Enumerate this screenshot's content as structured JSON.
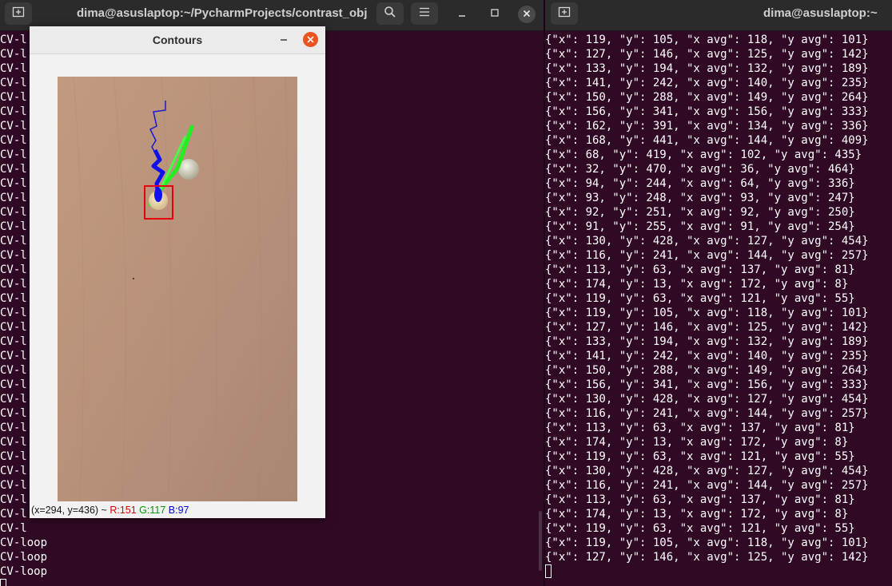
{
  "left_terminal": {
    "title": "dima@asuslaptop:~/PycharmProjects/contrast_obj",
    "lines": [
      "CV-l",
      "CV-l",
      "CV-l",
      "CV-l",
      "CV-l",
      "CV-l",
      "CV-l",
      "CV-l",
      "CV-l",
      "CV-l",
      "CV-l",
      "CV-l",
      "CV-l",
      "CV-l",
      "CV-l",
      "CV-l",
      "CV-l",
      "CV-l",
      "CV-l",
      "CV-l",
      "CV-l",
      "CV-l",
      "CV-l",
      "CV-l",
      "CV-l",
      "CV-l",
      "CV-l",
      "CV-l",
      "CV-l",
      "CV-l",
      "CV-l",
      "CV-l",
      "CV-l",
      "CV-l",
      "CV-l",
      "CV-loop",
      "CV-loop",
      "CV-loop"
    ]
  },
  "right_terminal": {
    "title": "dima@asuslaptop:~",
    "lines": [
      "{\"x\": 119, \"y\": 105, \"x avg\": 118, \"y avg\": 101}",
      "{\"x\": 127, \"y\": 146, \"x avg\": 125, \"y avg\": 142}",
      "{\"x\": 133, \"y\": 194, \"x avg\": 132, \"y avg\": 189}",
      "{\"x\": 141, \"y\": 242, \"x avg\": 140, \"y avg\": 235}",
      "{\"x\": 150, \"y\": 288, \"x avg\": 149, \"y avg\": 264}",
      "{\"x\": 156, \"y\": 341, \"x avg\": 156, \"y avg\": 333}",
      "{\"x\": 162, \"y\": 391, \"x avg\": 134, \"y avg\": 336}",
      "{\"x\": 168, \"y\": 441, \"x avg\": 144, \"y avg\": 409}",
      "{\"x\": 68, \"y\": 419, \"x avg\": 102, \"y avg\": 435}",
      "{\"x\": 32, \"y\": 470, \"x avg\": 36, \"y avg\": 464}",
      "{\"x\": 94, \"y\": 244, \"x avg\": 64, \"y avg\": 336}",
      "{\"x\": 93, \"y\": 248, \"x avg\": 93, \"y avg\": 247}",
      "{\"x\": 92, \"y\": 251, \"x avg\": 92, \"y avg\": 250}",
      "{\"x\": 91, \"y\": 255, \"x avg\": 91, \"y avg\": 254}",
      "{\"x\": 130, \"y\": 428, \"x avg\": 127, \"y avg\": 454}",
      "{\"x\": 116, \"y\": 241, \"x avg\": 144, \"y avg\": 257}",
      "{\"x\": 113, \"y\": 63, \"x avg\": 137, \"y avg\": 81}",
      "{\"x\": 174, \"y\": 13, \"x avg\": 172, \"y avg\": 8}",
      "{\"x\": 119, \"y\": 63, \"x avg\": 121, \"y avg\": 55}",
      "{\"x\": 119, \"y\": 105, \"x avg\": 118, \"y avg\": 101}",
      "{\"x\": 127, \"y\": 146, \"x avg\": 125, \"y avg\": 142}",
      "{\"x\": 133, \"y\": 194, \"x avg\": 132, \"y avg\": 189}",
      "{\"x\": 141, \"y\": 242, \"x avg\": 140, \"y avg\": 235}",
      "{\"x\": 150, \"y\": 288, \"x avg\": 149, \"y avg\": 264}",
      "{\"x\": 156, \"y\": 341, \"x avg\": 156, \"y avg\": 333}",
      "{\"x\": 130, \"y\": 428, \"x avg\": 127, \"y avg\": 454}",
      "{\"x\": 116, \"y\": 241, \"x avg\": 144, \"y avg\": 257}",
      "{\"x\": 113, \"y\": 63, \"x avg\": 137, \"y avg\": 81}",
      "{\"x\": 174, \"y\": 13, \"x avg\": 172, \"y avg\": 8}",
      "{\"x\": 119, \"y\": 63, \"x avg\": 121, \"y avg\": 55}",
      "{\"x\": 130, \"y\": 428, \"x avg\": 127, \"y avg\": 454}",
      "{\"x\": 116, \"y\": 241, \"x avg\": 144, \"y avg\": 257}",
      "{\"x\": 113, \"y\": 63, \"x avg\": 137, \"y avg\": 81}",
      "{\"x\": 174, \"y\": 13, \"x avg\": 172, \"y avg\": 8}",
      "{\"x\": 119, \"y\": 63, \"x avg\": 121, \"y avg\": 55}",
      "{\"x\": 119, \"y\": 105, \"x avg\": 118, \"y avg\": 101}",
      "{\"x\": 127, \"y\": 146, \"x avg\": 125, \"y avg\": 142}"
    ]
  },
  "contours_window": {
    "title": "Contours",
    "status_coords": "(x=294, y=436) ~ ",
    "status_r": "R:151",
    "status_g": "G:117",
    "status_b": "B:97"
  },
  "colors": {
    "terminal_bg": "#300a24",
    "close_accent": "#e95420",
    "status_r": "#d40000",
    "status_g": "#009900",
    "status_b": "#0000cc"
  },
  "icons": [
    "new-tab-icon",
    "search-icon",
    "hamburger-menu-icon",
    "minimize-icon",
    "maximize-icon",
    "close-icon"
  ]
}
